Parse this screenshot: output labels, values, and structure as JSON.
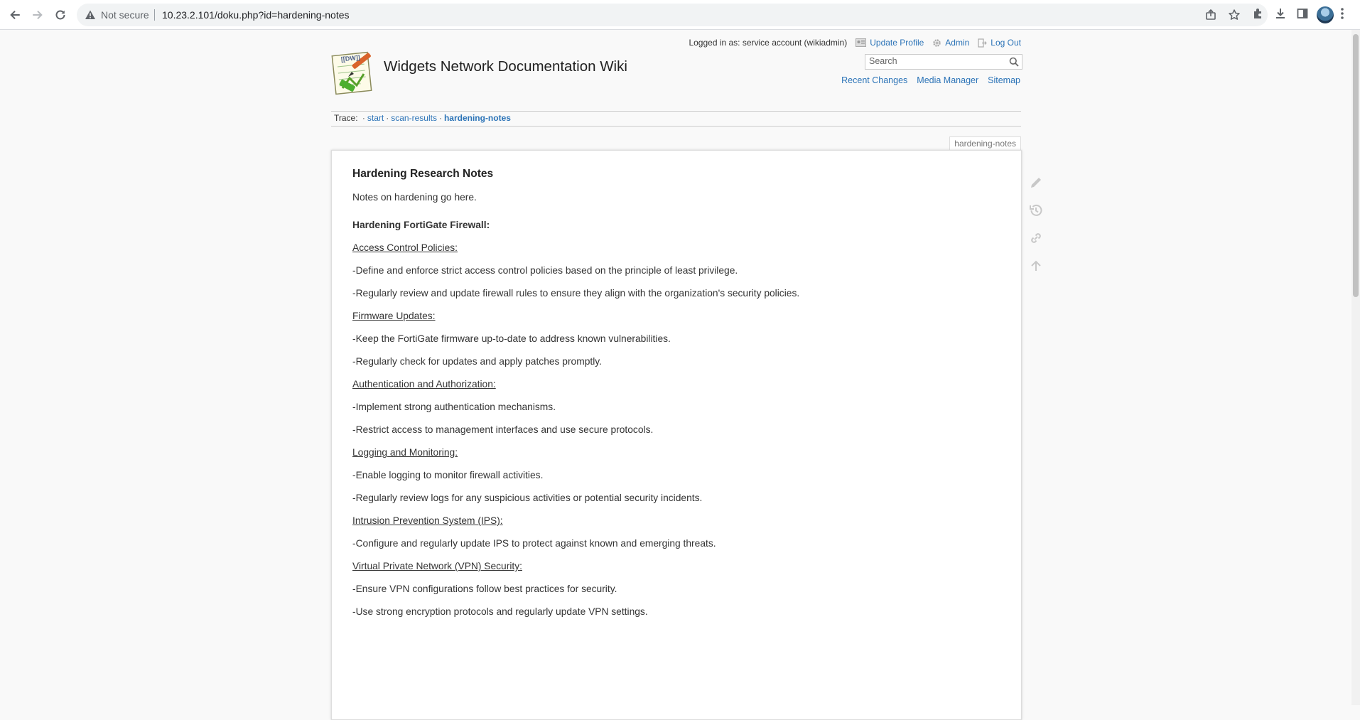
{
  "browser": {
    "security_label": "Not secure",
    "url": "10.23.2.101/doku.php?id=hardening-notes",
    "icons": [
      "back-icon",
      "forward-icon",
      "reload-icon",
      "warning-icon",
      "share-icon",
      "star-icon",
      "extensions-icon",
      "download-icon",
      "side-panel-icon",
      "profile-avatar",
      "menu-icon"
    ]
  },
  "header": {
    "logged_in": "Logged in as: service account (wikiadmin)",
    "update_profile": "Update Profile",
    "admin": "Admin",
    "logout": "Log Out",
    "site_title": "Widgets Network Documentation Wiki",
    "search_placeholder": "Search",
    "recent_changes": "Recent Changes",
    "media_manager": "Media Manager",
    "sitemap": "Sitemap"
  },
  "trace": {
    "label": "Trace:",
    "items": [
      "start",
      "scan-results",
      "hardening-notes"
    ]
  },
  "page": {
    "id_tab": "hardening-notes",
    "heading": "Hardening Research Notes",
    "intro": "Notes on hardening go here.",
    "section_title": "Hardening FortiGate Firewall:",
    "lines": [
      {
        "text": "Access Control Policies:",
        "style": "u"
      },
      {
        "text": "-Define and enforce strict access control policies based on the principle of least privilege.",
        "style": ""
      },
      {
        "text": "-Regularly review and update firewall rules to ensure they align with the organization's security policies.",
        "style": ""
      },
      {
        "text": "Firmware Updates:",
        "style": "u"
      },
      {
        "text": "-Keep the FortiGate firmware up-to-date to address known vulnerabilities.",
        "style": ""
      },
      {
        "text": "-Regularly check for updates and apply patches promptly.",
        "style": ""
      },
      {
        "text": "Authentication and Authorization:",
        "style": "u"
      },
      {
        "text": "-Implement strong authentication mechanisms.",
        "style": ""
      },
      {
        "text": "-Restrict access to management interfaces and use secure protocols.",
        "style": ""
      },
      {
        "text": "Logging and Monitoring:",
        "style": "u"
      },
      {
        "text": "-Enable logging to monitor firewall activities.",
        "style": ""
      },
      {
        "text": "-Regularly review logs for any suspicious activities or potential security incidents.",
        "style": ""
      },
      {
        "text": "Intrusion Prevention System (IPS):",
        "style": "u"
      },
      {
        "text": "-Configure and regularly update IPS to protect against known and emerging threats.",
        "style": ""
      },
      {
        "text": "Virtual Private Network (VPN) Security:",
        "style": "u"
      },
      {
        "text": "-Ensure VPN configurations follow best practices for security.",
        "style": ""
      },
      {
        "text": "-Use strong encryption protocols and regularly update VPN settings.",
        "style": ""
      }
    ],
    "tools": [
      "edit-icon",
      "revisions-icon",
      "backlinks-icon",
      "back-to-top-icon"
    ]
  }
}
